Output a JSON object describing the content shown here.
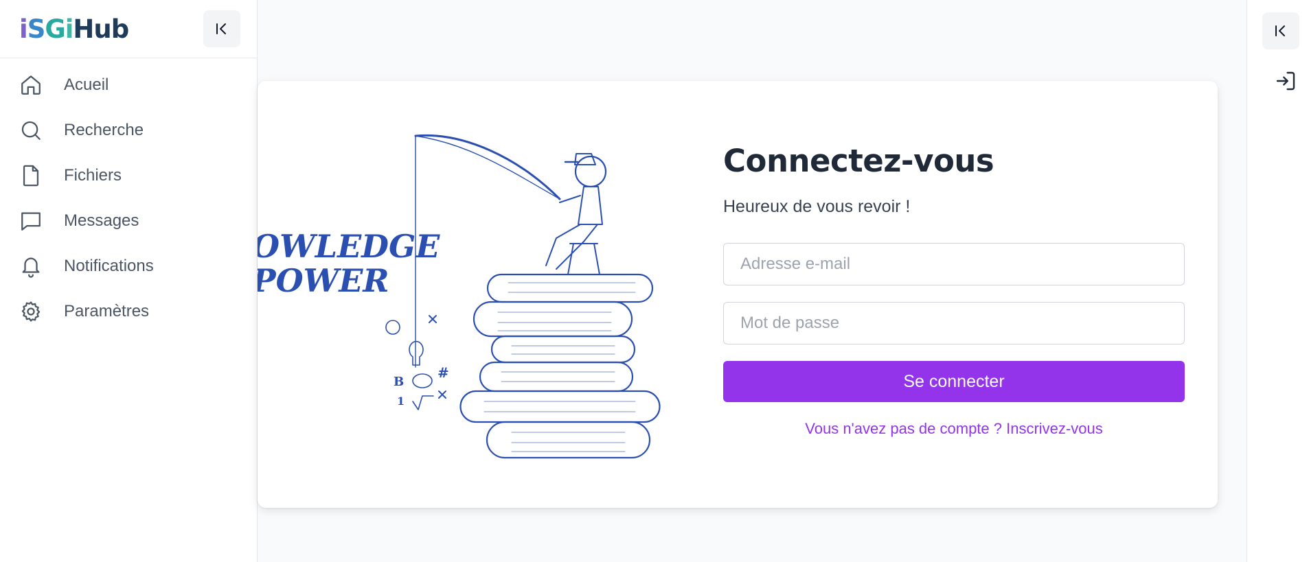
{
  "brand": {
    "logo_parts": [
      "i",
      "S",
      "G",
      "i",
      "Hub"
    ]
  },
  "sidebar": {
    "items": [
      {
        "label": "Acueil",
        "icon": "home-icon"
      },
      {
        "label": "Recherche",
        "icon": "search-icon"
      },
      {
        "label": "Fichiers",
        "icon": "file-icon"
      },
      {
        "label": "Messages",
        "icon": "message-icon"
      },
      {
        "label": "Notifications",
        "icon": "bell-icon"
      },
      {
        "label": "Paramètres",
        "icon": "gear-icon"
      }
    ]
  },
  "illustration": {
    "text_line1": "OWLEDGE",
    "text_line2": "POWER"
  },
  "login": {
    "title": "Connectez-vous",
    "subtitle": "Heureux de vous revoir !",
    "email_placeholder": "Adresse e-mail",
    "password_placeholder": "Mot de passe",
    "submit_label": "Se connecter",
    "register_text": "Vous n'avez pas de compte ? Inscrivez-vous"
  },
  "colors": {
    "accent": "#9333ea",
    "illustration_ink": "#2a4fb0"
  }
}
